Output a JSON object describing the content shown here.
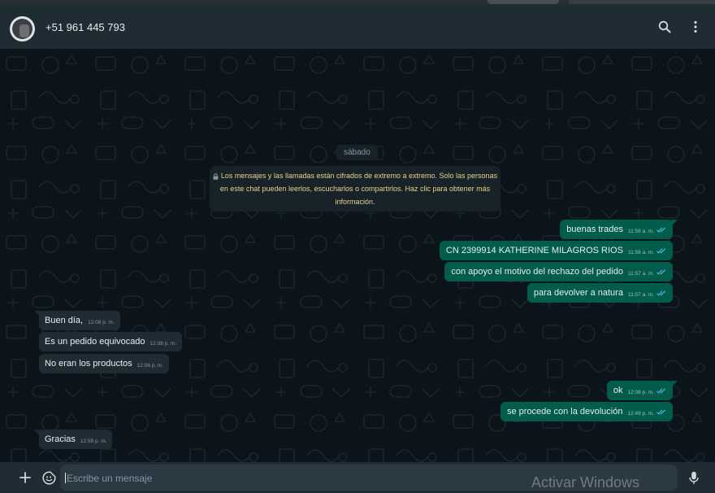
{
  "contact": {
    "phone": "+51 961 445 793"
  },
  "chat": {
    "date_chip": "sábado",
    "encryption_notice": [
      "Los mensajes y las llamadas están cifrados de extremo a extremo. Solo las personas",
      "en este chat pueden leerlos, escucharlos o compartirlos. Haz clic para obtener más",
      "información."
    ],
    "messages": [
      {
        "dir": "out",
        "text": "buenas trades",
        "time": "11:56 a. m."
      },
      {
        "dir": "out",
        "text": "CN 2399914 KATHERINE MILAGROS RIOS",
        "time": "11:56 a. m."
      },
      {
        "dir": "out",
        "text": "con apoyo el motivo del rechazo del pedido",
        "time": "11:57 a. m."
      },
      {
        "dir": "out",
        "text": "para devolver a natura",
        "time": "11:57 a. m."
      },
      {
        "dir": "in",
        "text": "Buen día,",
        "time": "12:08 p. m."
      },
      {
        "dir": "in",
        "text": "Es un pedido equivocado",
        "time": "12:08 p. m."
      },
      {
        "dir": "in",
        "text": "No eran los productos",
        "time": "12:08 p. m."
      },
      {
        "dir": "out",
        "text": "ok",
        "time": "12:08 p. m."
      },
      {
        "dir": "out",
        "text": "se procede con la devolución",
        "time": "12:49 p. m."
      },
      {
        "dir": "in",
        "text": "Gracias",
        "time": "12:59 p. m."
      }
    ]
  },
  "composer": {
    "placeholder": "Escribe un mensaje"
  },
  "overlay": {
    "watermark": "Activar Windows"
  },
  "icons": {
    "search": "search-icon",
    "menu": "kebab-menu-icon",
    "attach": "plus-icon",
    "emoji": "sticker-icon",
    "mic": "microphone-icon",
    "lock": "lock-icon",
    "read": "double-check-icon"
  },
  "colors": {
    "outgoing": "#005c4b",
    "incoming": "#202c33",
    "read_ticks": "#53bdeb",
    "header": "#202c33",
    "background": "#0b141a"
  }
}
